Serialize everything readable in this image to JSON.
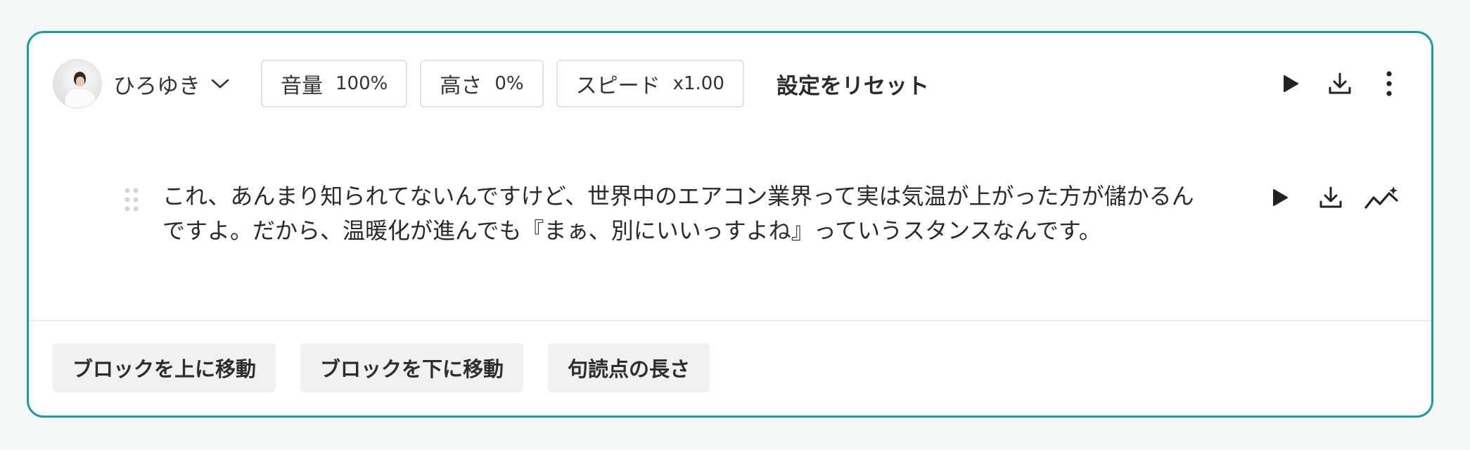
{
  "voice": {
    "name": "ひろゆき"
  },
  "params": {
    "volume": {
      "label": "音量",
      "value": "100%"
    },
    "pitch": {
      "label": "高さ",
      "value": "0%"
    },
    "speed": {
      "label": "スピード",
      "value": "x1.00"
    }
  },
  "toolbar": {
    "reset_label": "設定をリセット",
    "icons": [
      "play-icon",
      "download-icon",
      "more-vertical-icon"
    ]
  },
  "block": {
    "text": "これ、あんまり知られてないんですけど、世界中のエアコン業界って実は気温が上がった方が儲かるんですよ。だから、温暖化が進んでも『まぁ、別にいいっすよね』っていうスタンスなんです。",
    "icons": [
      "drag-handle-icon",
      "play-icon",
      "download-icon",
      "sparkle-chart-icon"
    ]
  },
  "footer": {
    "move_up_label": "ブロックを上に移動",
    "move_down_label": "ブロックを下に移動",
    "pause_length_label": "句読点の長さ"
  },
  "colors": {
    "accent_border": "#1a9c98",
    "background": "#f6f7f7"
  }
}
